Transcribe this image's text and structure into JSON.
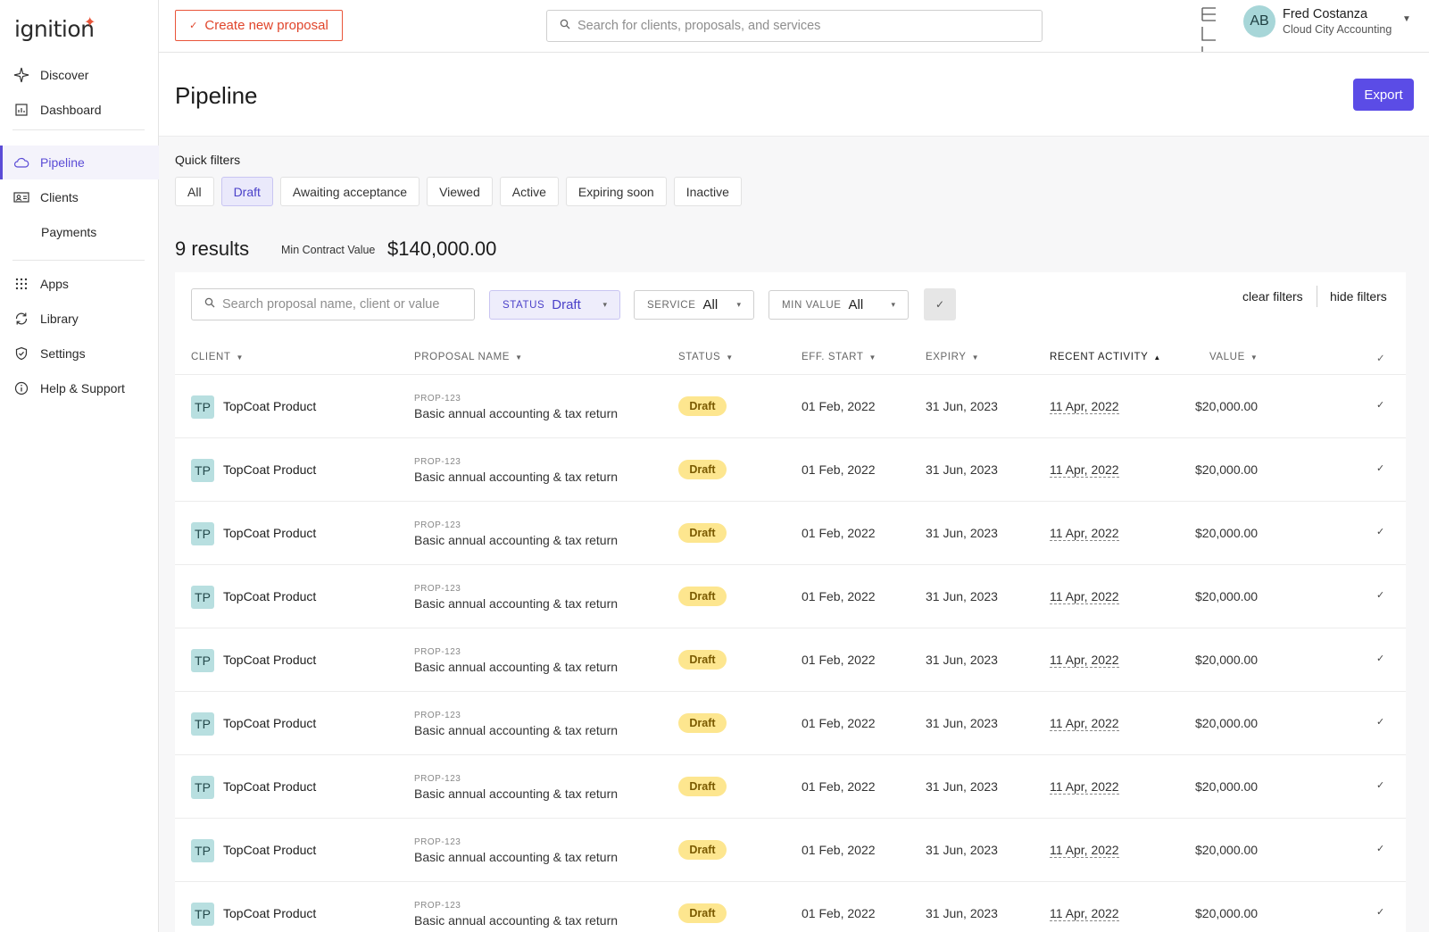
{
  "app": {
    "logo_text": "ignition",
    "logo_mark": "✦"
  },
  "sidebar": {
    "items": [
      {
        "label": "Discover",
        "icon": "sparkle-icon"
      },
      {
        "label": "Dashboard",
        "icon": "chart-icon"
      },
      {
        "label": "Pipeline",
        "icon": "cloud-icon"
      },
      {
        "label": "Clients",
        "icon": "id-card-icon"
      },
      {
        "label": "Payments",
        "icon": ""
      },
      {
        "label": "Apps",
        "icon": "grid-icon"
      },
      {
        "label": "Library",
        "icon": "sync-icon"
      },
      {
        "label": "Settings",
        "icon": "shield-icon"
      },
      {
        "label": "Help & Support",
        "icon": "info-icon"
      }
    ],
    "active": "Pipeline"
  },
  "topbar": {
    "create_label": "Create new proposal",
    "search_placeholder": "Search for clients, proposals, and services",
    "user_initials": "AB",
    "user_name": "Fred Costanza",
    "user_org": "Cloud City Accounting"
  },
  "page": {
    "title": "Pipeline",
    "export_label": "Export",
    "quick_filters_label": "Quick filters",
    "quick_filters": [
      "All",
      "Draft",
      "Awaiting acceptance",
      "Viewed",
      "Active",
      "Expiring soon",
      "Inactive"
    ],
    "quick_filter_selected": "Draft",
    "results": "9 results",
    "min_contract_label": "Min Contract Value",
    "min_contract_value": "$140,000.00"
  },
  "filters": {
    "search_placeholder": "Search proposal name, client or value",
    "status_key": "STATUS",
    "status_value": "Draft",
    "service_key": "SERVICE",
    "service_value": "All",
    "minvalue_key": "MIN VALUE",
    "minvalue_value": "All",
    "clear_label": "clear filters",
    "hide_label": "hide filters"
  },
  "table": {
    "headers": {
      "client": "CLIENT",
      "proposal": "PROPOSAL NAME",
      "status": "STATUS",
      "start": "EFF. START",
      "expiry": "EXPIRY",
      "recent": "RECENT ACTIVITY",
      "value": "VALUE"
    },
    "sorted_by": "RECENT ACTIVITY",
    "rows": [
      {
        "initials": "TP",
        "client": "TopCoat Product",
        "proposal_id": "PROP-123",
        "proposal_name": "Basic annual accounting & tax return",
        "status": "Draft",
        "start": "01 Feb, 2022",
        "expiry": "31 Jun, 2023",
        "recent": "11 Apr, 2022",
        "value": "$20,000.00"
      },
      {
        "initials": "TP",
        "client": "TopCoat Product",
        "proposal_id": "PROP-123",
        "proposal_name": "Basic annual accounting & tax return",
        "status": "Draft",
        "start": "01 Feb, 2022",
        "expiry": "31 Jun, 2023",
        "recent": "11 Apr, 2022",
        "value": "$20,000.00"
      },
      {
        "initials": "TP",
        "client": "TopCoat Product",
        "proposal_id": "PROP-123",
        "proposal_name": "Basic annual accounting & tax return",
        "status": "Draft",
        "start": "01 Feb, 2022",
        "expiry": "31 Jun, 2023",
        "recent": "11 Apr, 2022",
        "value": "$20,000.00"
      },
      {
        "initials": "TP",
        "client": "TopCoat Product",
        "proposal_id": "PROP-123",
        "proposal_name": "Basic annual accounting & tax return",
        "status": "Draft",
        "start": "01 Feb, 2022",
        "expiry": "31 Jun, 2023",
        "recent": "11 Apr, 2022",
        "value": "$20,000.00"
      },
      {
        "initials": "TP",
        "client": "TopCoat Product",
        "proposal_id": "PROP-123",
        "proposal_name": "Basic annual accounting & tax return",
        "status": "Draft",
        "start": "01 Feb, 2022",
        "expiry": "31 Jun, 2023",
        "recent": "11 Apr, 2022",
        "value": "$20,000.00"
      },
      {
        "initials": "TP",
        "client": "TopCoat Product",
        "proposal_id": "PROP-123",
        "proposal_name": "Basic annual accounting & tax return",
        "status": "Draft",
        "start": "01 Feb, 2022",
        "expiry": "31 Jun, 2023",
        "recent": "11 Apr, 2022",
        "value": "$20,000.00"
      },
      {
        "initials": "TP",
        "client": "TopCoat Product",
        "proposal_id": "PROP-123",
        "proposal_name": "Basic annual accounting & tax return",
        "status": "Draft",
        "start": "01 Feb, 2022",
        "expiry": "31 Jun, 2023",
        "recent": "11 Apr, 2022",
        "value": "$20,000.00"
      },
      {
        "initials": "TP",
        "client": "TopCoat Product",
        "proposal_id": "PROP-123",
        "proposal_name": "Basic annual accounting & tax return",
        "status": "Draft",
        "start": "01 Feb, 2022",
        "expiry": "31 Jun, 2023",
        "recent": "11 Apr, 2022",
        "value": "$20,000.00"
      },
      {
        "initials": "TP",
        "client": "TopCoat Product",
        "proposal_id": "PROP-123",
        "proposal_name": "Basic annual accounting & tax return",
        "status": "Draft",
        "start": "01 Feb, 2022",
        "expiry": "31 Jun, 2023",
        "recent": "11 Apr, 2022",
        "value": "$20,000.00"
      }
    ]
  },
  "colors": {
    "accent": "#5b4ce6",
    "brand": "#e9553a",
    "draft_badge": "#fde68f"
  }
}
